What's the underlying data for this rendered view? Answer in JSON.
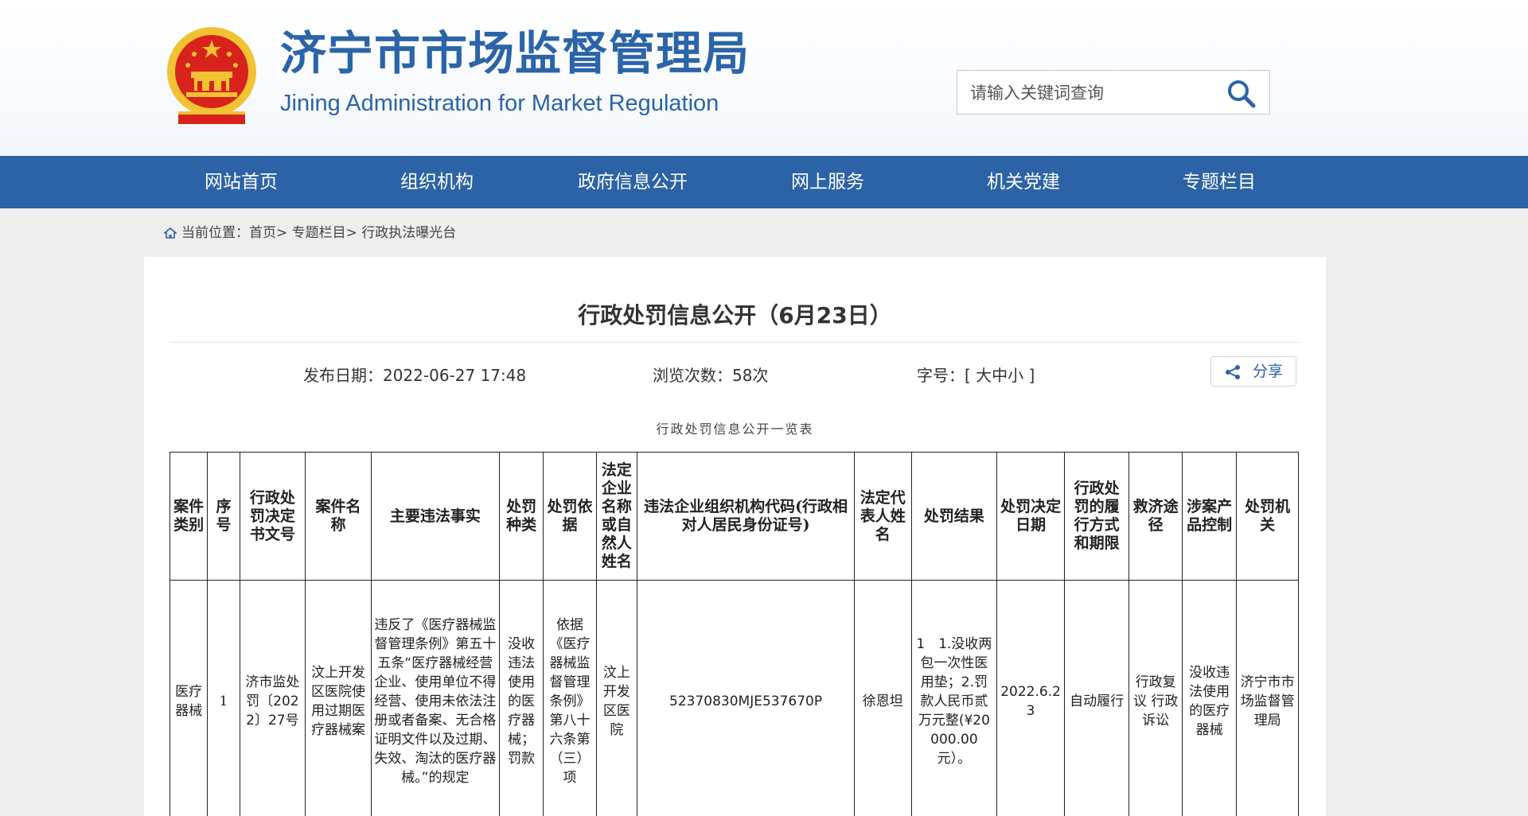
{
  "header": {
    "title_cn": "济宁市市场监督管理局",
    "title_en": "Jining Administration for Market Regulation",
    "search_placeholder": "请输入关键词查询"
  },
  "nav": {
    "items": [
      {
        "label": "网站首页"
      },
      {
        "label": "组织机构"
      },
      {
        "label": "政府信息公开"
      },
      {
        "label": "网上服务"
      },
      {
        "label": "机关党建"
      },
      {
        "label": "专题栏目"
      }
    ]
  },
  "breadcrumb": {
    "prefix": "当前位置：",
    "items": [
      {
        "label": "首页>"
      },
      {
        "label": "专题栏目>"
      },
      {
        "label": "行政执法曝光台"
      }
    ]
  },
  "article": {
    "title": "行政处罚信息公开（6月23日）",
    "publish_date": "发布日期：2022-06-27 17:48",
    "views": "浏览次数：58次",
    "font_size": "字号：[ 大中小 ]",
    "share_label": "分享",
    "table_caption": "行政处罚信息公开一览表"
  },
  "table": {
    "headers": [
      "案件类别",
      "序号",
      "行政处罚决定书文号",
      "案件名称",
      "主要违法事实",
      "处罚种类",
      "处罚依据",
      "法定企业名称或自然人姓名",
      "违法企业组织机构代码(行政相对人居民身份证号)",
      "法定代表人姓名",
      "处罚结果",
      "处罚决定日期",
      "行政处罚的履行方式和期限",
      "救济途径",
      "涉案产品控制",
      "处罚机关"
    ],
    "rows": [
      [
        "医疗器械",
        "1",
        "济市监处罚〔2022〕27号",
        "汶上开发区医院使用过期医疗器械案",
        "违反了《医疗器械监督管理条例》第五十五条“医疗器械经营企业、使用单位不得经营、使用未依法注册或者备案、无合格证明文件以及过期、失效、淘汰的医疗器械。”的规定",
        "没收违法使用的医疗器械；罚款",
        "依据《医疗器械监督管理条例》第八十六条第（三）项",
        "汶上开发区医院",
        "52370830MJE537670P",
        "徐恩坦",
        "1　1.没收两包一次性医用垫；2.罚款人民币贰万元整(¥20000.00元）。",
        "2022.6.23",
        "自动履行",
        "行政复议 行政诉讼",
        "没收违法使用的医疗器械",
        "济宁市市场监督管理局"
      ]
    ]
  },
  "colors": {
    "brand_blue": "#2b63a6",
    "title_blue": "#2b64a8",
    "emblem_red": "#d7231b",
    "emblem_gold": "#f3c233"
  }
}
